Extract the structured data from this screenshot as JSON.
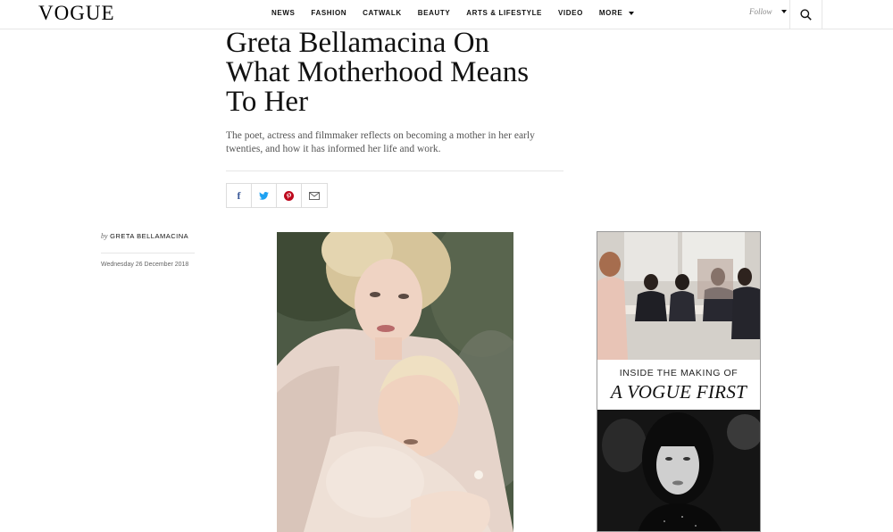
{
  "header": {
    "logo": "VOGUE",
    "nav": [
      "NEWS",
      "FASHION",
      "CATWALK",
      "BEAUTY",
      "ARTS & LIFESTYLE",
      "VIDEO"
    ],
    "more_label": "MORE",
    "follow_label": "Follow",
    "icons": {
      "search": "search-icon",
      "caret": "chevron-down-icon"
    }
  },
  "article": {
    "title_lines": [
      "Greta Bellamacina On",
      "What Motherhood Means",
      "To Her"
    ],
    "dek_lines": [
      "The poet, actress and filmmaker reflects on becoming a mother in her early",
      "twenties, and how it has informed her life and work."
    ],
    "share": [
      {
        "name": "facebook-icon",
        "glyph": "f"
      },
      {
        "name": "twitter-icon"
      },
      {
        "name": "pinterest-icon"
      },
      {
        "name": "email-icon"
      }
    ],
    "byline_prefix": "by",
    "author": "GRETA BELLAMACINA",
    "date": "Wednesday 26 December 2018"
  },
  "ad": {
    "line1": "INSIDE THE MAKING OF",
    "line2": "A VOGUE FIRST"
  },
  "colors": {
    "facebook": "#3b5998",
    "twitter": "#1da1f2",
    "pinterest": "#bd081c"
  }
}
